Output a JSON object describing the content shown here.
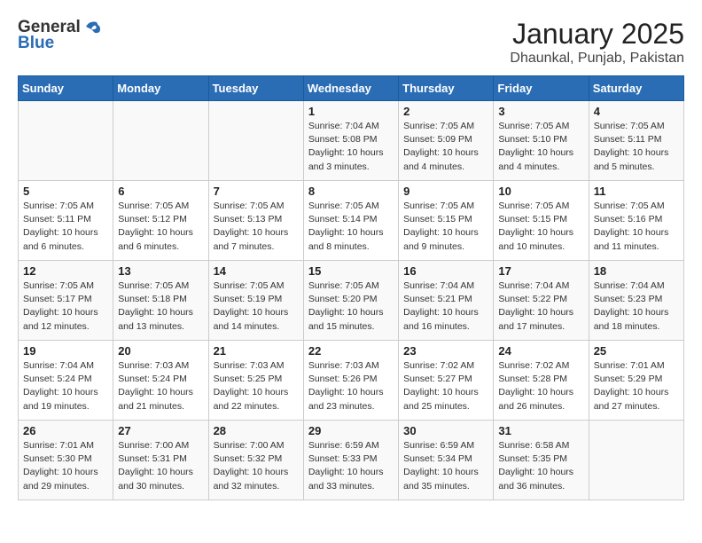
{
  "header": {
    "logo_general": "General",
    "logo_blue": "Blue",
    "title": "January 2025",
    "subtitle": "Dhaunkal, Punjab, Pakistan"
  },
  "days_of_week": [
    "Sunday",
    "Monday",
    "Tuesday",
    "Wednesday",
    "Thursday",
    "Friday",
    "Saturday"
  ],
  "weeks": [
    [
      {
        "day": "",
        "info": ""
      },
      {
        "day": "",
        "info": ""
      },
      {
        "day": "",
        "info": ""
      },
      {
        "day": "1",
        "info": "Sunrise: 7:04 AM\nSunset: 5:08 PM\nDaylight: 10 hours and 3 minutes."
      },
      {
        "day": "2",
        "info": "Sunrise: 7:05 AM\nSunset: 5:09 PM\nDaylight: 10 hours and 4 minutes."
      },
      {
        "day": "3",
        "info": "Sunrise: 7:05 AM\nSunset: 5:10 PM\nDaylight: 10 hours and 4 minutes."
      },
      {
        "day": "4",
        "info": "Sunrise: 7:05 AM\nSunset: 5:11 PM\nDaylight: 10 hours and 5 minutes."
      }
    ],
    [
      {
        "day": "5",
        "info": "Sunrise: 7:05 AM\nSunset: 5:11 PM\nDaylight: 10 hours and 6 minutes."
      },
      {
        "day": "6",
        "info": "Sunrise: 7:05 AM\nSunset: 5:12 PM\nDaylight: 10 hours and 6 minutes."
      },
      {
        "day": "7",
        "info": "Sunrise: 7:05 AM\nSunset: 5:13 PM\nDaylight: 10 hours and 7 minutes."
      },
      {
        "day": "8",
        "info": "Sunrise: 7:05 AM\nSunset: 5:14 PM\nDaylight: 10 hours and 8 minutes."
      },
      {
        "day": "9",
        "info": "Sunrise: 7:05 AM\nSunset: 5:15 PM\nDaylight: 10 hours and 9 minutes."
      },
      {
        "day": "10",
        "info": "Sunrise: 7:05 AM\nSunset: 5:15 PM\nDaylight: 10 hours and 10 minutes."
      },
      {
        "day": "11",
        "info": "Sunrise: 7:05 AM\nSunset: 5:16 PM\nDaylight: 10 hours and 11 minutes."
      }
    ],
    [
      {
        "day": "12",
        "info": "Sunrise: 7:05 AM\nSunset: 5:17 PM\nDaylight: 10 hours and 12 minutes."
      },
      {
        "day": "13",
        "info": "Sunrise: 7:05 AM\nSunset: 5:18 PM\nDaylight: 10 hours and 13 minutes."
      },
      {
        "day": "14",
        "info": "Sunrise: 7:05 AM\nSunset: 5:19 PM\nDaylight: 10 hours and 14 minutes."
      },
      {
        "day": "15",
        "info": "Sunrise: 7:05 AM\nSunset: 5:20 PM\nDaylight: 10 hours and 15 minutes."
      },
      {
        "day": "16",
        "info": "Sunrise: 7:04 AM\nSunset: 5:21 PM\nDaylight: 10 hours and 16 minutes."
      },
      {
        "day": "17",
        "info": "Sunrise: 7:04 AM\nSunset: 5:22 PM\nDaylight: 10 hours and 17 minutes."
      },
      {
        "day": "18",
        "info": "Sunrise: 7:04 AM\nSunset: 5:23 PM\nDaylight: 10 hours and 18 minutes."
      }
    ],
    [
      {
        "day": "19",
        "info": "Sunrise: 7:04 AM\nSunset: 5:24 PM\nDaylight: 10 hours and 19 minutes."
      },
      {
        "day": "20",
        "info": "Sunrise: 7:03 AM\nSunset: 5:24 PM\nDaylight: 10 hours and 21 minutes."
      },
      {
        "day": "21",
        "info": "Sunrise: 7:03 AM\nSunset: 5:25 PM\nDaylight: 10 hours and 22 minutes."
      },
      {
        "day": "22",
        "info": "Sunrise: 7:03 AM\nSunset: 5:26 PM\nDaylight: 10 hours and 23 minutes."
      },
      {
        "day": "23",
        "info": "Sunrise: 7:02 AM\nSunset: 5:27 PM\nDaylight: 10 hours and 25 minutes."
      },
      {
        "day": "24",
        "info": "Sunrise: 7:02 AM\nSunset: 5:28 PM\nDaylight: 10 hours and 26 minutes."
      },
      {
        "day": "25",
        "info": "Sunrise: 7:01 AM\nSunset: 5:29 PM\nDaylight: 10 hours and 27 minutes."
      }
    ],
    [
      {
        "day": "26",
        "info": "Sunrise: 7:01 AM\nSunset: 5:30 PM\nDaylight: 10 hours and 29 minutes."
      },
      {
        "day": "27",
        "info": "Sunrise: 7:00 AM\nSunset: 5:31 PM\nDaylight: 10 hours and 30 minutes."
      },
      {
        "day": "28",
        "info": "Sunrise: 7:00 AM\nSunset: 5:32 PM\nDaylight: 10 hours and 32 minutes."
      },
      {
        "day": "29",
        "info": "Sunrise: 6:59 AM\nSunset: 5:33 PM\nDaylight: 10 hours and 33 minutes."
      },
      {
        "day": "30",
        "info": "Sunrise: 6:59 AM\nSunset: 5:34 PM\nDaylight: 10 hours and 35 minutes."
      },
      {
        "day": "31",
        "info": "Sunrise: 6:58 AM\nSunset: 5:35 PM\nDaylight: 10 hours and 36 minutes."
      },
      {
        "day": "",
        "info": ""
      }
    ]
  ]
}
